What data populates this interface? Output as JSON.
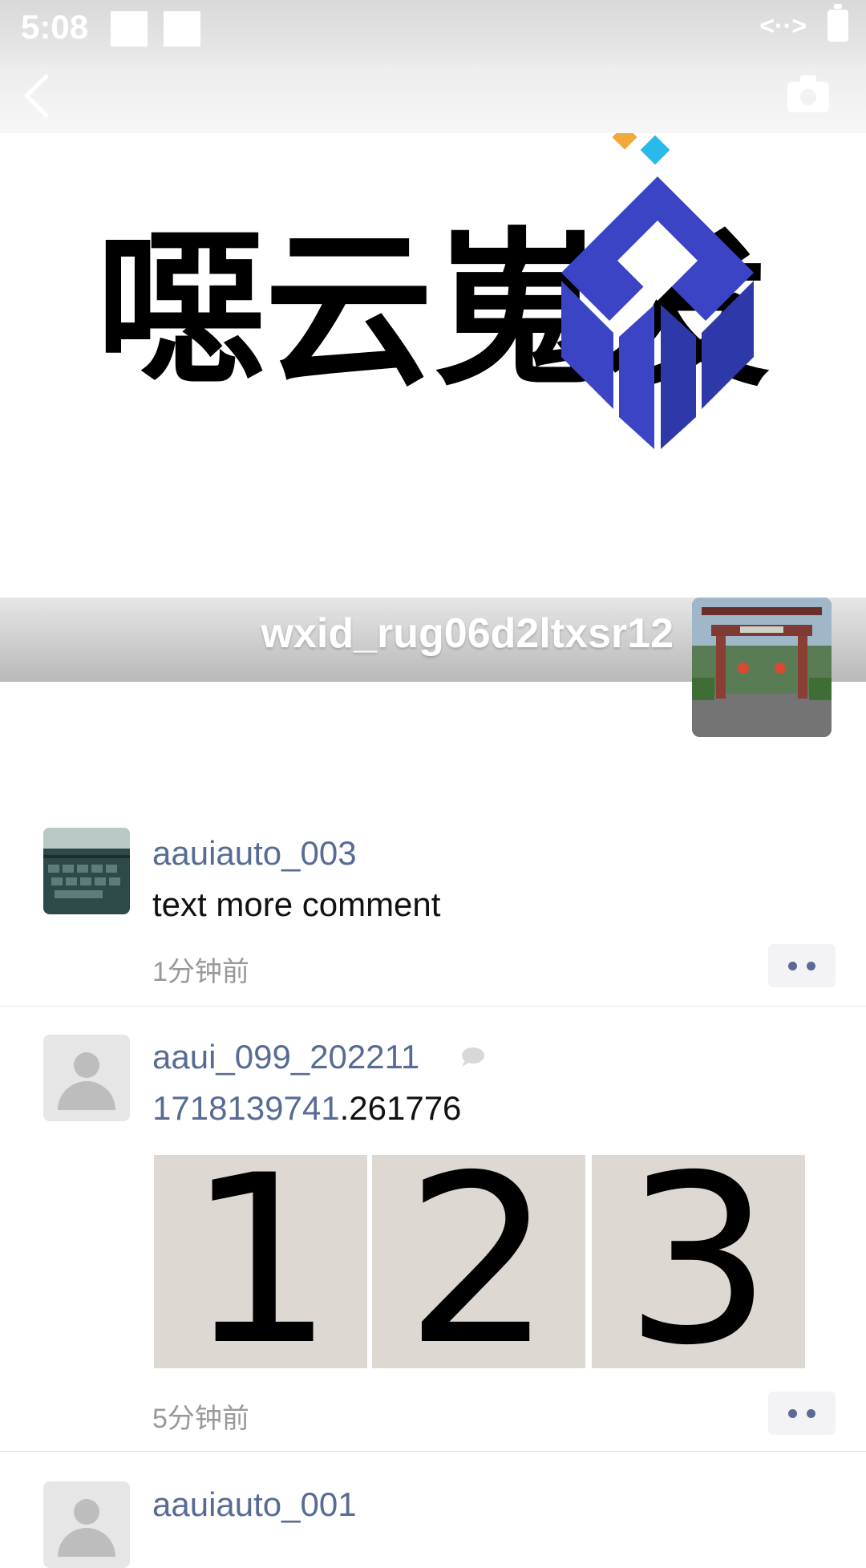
{
  "status_bar": {
    "time": "5:08",
    "right_icon": "<··>"
  },
  "profile": {
    "name": "wxid_rug06d2ltxsr12"
  },
  "cover": {
    "logo_text": "噁云嵬发"
  },
  "posts": [
    {
      "username": "aauiauto_003",
      "text": "text more comment",
      "time": "1分钟前"
    },
    {
      "username": "aaui_099_202211",
      "text_link": "1718139741",
      "text_rest": ".261776",
      "photos": [
        "1",
        "2",
        "3"
      ],
      "time": "5分钟前"
    },
    {
      "username": "aauiauto_001"
    }
  ],
  "colors": {
    "link": "#576b95",
    "logo_blue": "#3b44c4",
    "logo_orange": "#f0a93a",
    "logo_cyan": "#29b9ea"
  },
  "icons": [
    "back-icon",
    "camera-icon",
    "more-icon",
    "moments-icon",
    "battery-icon"
  ]
}
